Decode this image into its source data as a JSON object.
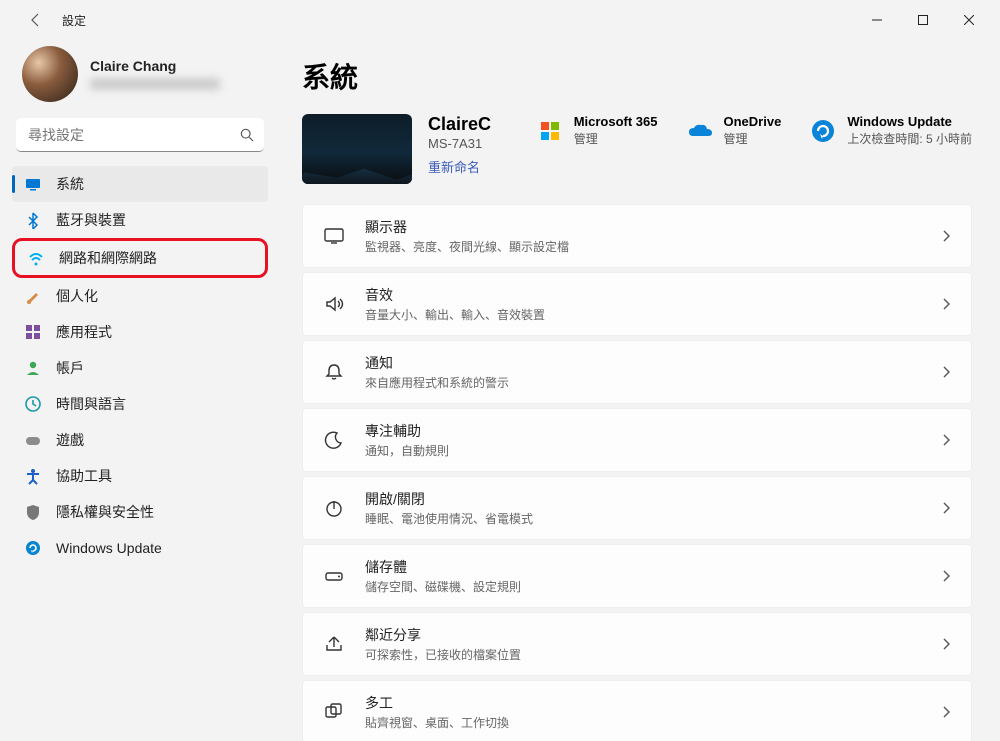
{
  "titlebar": {
    "title": "設定"
  },
  "profile": {
    "name": "Claire Chang"
  },
  "search": {
    "placeholder": "尋找設定"
  },
  "sidebar": {
    "items": [
      {
        "label": "系統",
        "iconColor": "#0078d4",
        "icon": "system"
      },
      {
        "label": "藍牙與裝置",
        "iconColor": "#0078d4",
        "icon": "bluetooth"
      },
      {
        "label": "網路和網際網路",
        "iconColor": "#00b0f0",
        "icon": "wifi"
      },
      {
        "label": "個人化",
        "iconColor": "#d88b44",
        "icon": "brush"
      },
      {
        "label": "應用程式",
        "iconColor": "#7b4f9e",
        "icon": "apps"
      },
      {
        "label": "帳戶",
        "iconColor": "#3ba757",
        "icon": "account"
      },
      {
        "label": "時間與語言",
        "iconColor": "#1a99a8",
        "icon": "time"
      },
      {
        "label": "遊戲",
        "iconColor": "#8c8c8c",
        "icon": "game"
      },
      {
        "label": "協助工具",
        "iconColor": "#1c60c8",
        "icon": "access"
      },
      {
        "label": "隱私權與安全性",
        "iconColor": "#777",
        "icon": "shield"
      },
      {
        "label": "Windows Update",
        "iconColor": "#0785cf",
        "icon": "update"
      }
    ]
  },
  "page": {
    "title": "系統",
    "device": {
      "name": "ClaireC",
      "model": "MS-7A31",
      "rename": "重新命名"
    },
    "links": [
      {
        "title": "Microsoft 365",
        "sub": "管理"
      },
      {
        "title": "OneDrive",
        "sub": "管理"
      },
      {
        "title": "Windows Update",
        "sub": "上次檢查時間: 5 小時前"
      }
    ],
    "cards": [
      {
        "title": "顯示器",
        "sub": "監視器、亮度、夜間光線、顯示設定檔",
        "icon": "display"
      },
      {
        "title": "音效",
        "sub": "音量大小、輸出、輸入、音效裝置",
        "icon": "sound"
      },
      {
        "title": "通知",
        "sub": "來自應用程式和系統的警示",
        "icon": "bell"
      },
      {
        "title": "專注輔助",
        "sub": "通知，自動規則",
        "icon": "moon"
      },
      {
        "title": "開啟/關閉",
        "sub": "睡眠、電池使用情況、省電模式",
        "icon": "power"
      },
      {
        "title": "儲存體",
        "sub": "儲存空間、磁碟機、設定規則",
        "icon": "storage"
      },
      {
        "title": "鄰近分享",
        "sub": "可探索性，已接收的檔案位置",
        "icon": "share"
      },
      {
        "title": "多工",
        "sub": "貼齊視窗、桌面、工作切換",
        "icon": "multi"
      }
    ]
  }
}
